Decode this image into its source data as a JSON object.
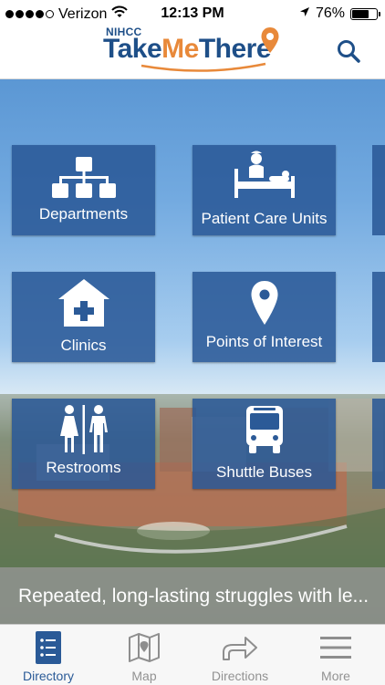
{
  "status_bar": {
    "carrier": "Verizon",
    "time": "12:13 PM",
    "battery_percent": "76%",
    "battery_level": 0.76,
    "signal_bars": 4,
    "icons": [
      "signal-icon",
      "wifi-icon",
      "location-arrow-icon",
      "battery-icon"
    ]
  },
  "header": {
    "logo_small": "NIHCC",
    "logo_part1": "Take",
    "logo_part2": "Me",
    "logo_part3": "There",
    "search_icon": "search-icon"
  },
  "colors": {
    "brand_blue": "#1e4f88",
    "brand_orange": "#e8893a",
    "tile_blue": "#295796",
    "tab_active": "#2a5a97",
    "tab_inactive": "#929292"
  },
  "tiles": [
    {
      "label": "Departments",
      "icon": "org-chart-icon"
    },
    {
      "label": "Patient Care Units",
      "icon": "patient-bed-icon"
    },
    {
      "label": "Clinics",
      "icon": "clinic-cross-icon"
    },
    {
      "label": "Points of Interest",
      "icon": "map-pin-icon"
    },
    {
      "label": "Restrooms",
      "icon": "restroom-icon"
    },
    {
      "label": "Shuttle Buses",
      "icon": "bus-icon"
    }
  ],
  "ticker": {
    "text": "Repeated, long-lasting struggles with le..."
  },
  "tabbar": {
    "items": [
      {
        "label": "Directory",
        "icon": "directory-list-icon",
        "active": true
      },
      {
        "label": "Map",
        "icon": "map-icon",
        "active": false
      },
      {
        "label": "Directions",
        "icon": "directions-arrow-icon",
        "active": false
      },
      {
        "label": "More",
        "icon": "menu-icon",
        "active": false
      }
    ]
  }
}
